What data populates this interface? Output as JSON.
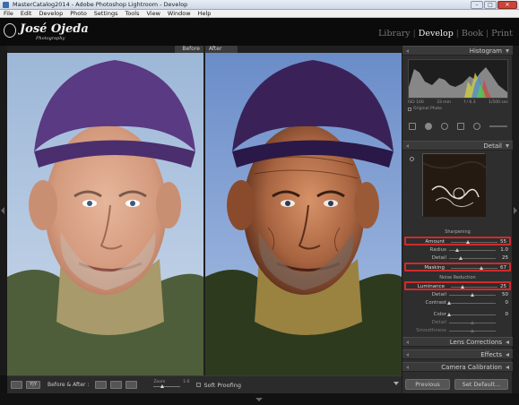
{
  "window": {
    "title": "MasterCatalog2014 - Adobe Photoshop Lightroom - Develop",
    "controls": {
      "minimize": "–",
      "maximize": "□",
      "close": "✕"
    }
  },
  "menu": [
    "File",
    "Edit",
    "Develop",
    "Photo",
    "Settings",
    "Tools",
    "View",
    "Window",
    "Help"
  ],
  "identity": {
    "name": "José Ojeda",
    "tagline": "Photography"
  },
  "modules": [
    {
      "label": "Library",
      "active": false
    },
    {
      "label": "Develop",
      "active": true
    },
    {
      "label": "Book",
      "active": false
    },
    {
      "label": "Print",
      "active": false
    }
  ],
  "preview": {
    "before_label": "Before",
    "after_label": "After"
  },
  "toolbar": {
    "before_after_label": "Before & After :",
    "zoom_label": "Zoom",
    "zoom_value": "1:6",
    "soft_proofing_label": "Soft Proofing"
  },
  "histogram": {
    "title": "Histogram",
    "info": [
      "ISO 100",
      "33 mm",
      "f / 6.3",
      "1/500 sec"
    ],
    "original_photo_label": "Original Photo"
  },
  "detail": {
    "title": "Detail",
    "sharpening_header": "Sharpening",
    "sharpening": [
      {
        "label": "Amount",
        "value": "55",
        "pct": 0.37,
        "highlight": true
      },
      {
        "label": "Radius",
        "value": "1.0",
        "pct": 0.18,
        "highlight": false
      },
      {
        "label": "Detail",
        "value": "25",
        "pct": 0.25,
        "highlight": false
      },
      {
        "label": "Masking",
        "value": "67",
        "pct": 0.67,
        "highlight": true
      }
    ],
    "noise_header": "Noise Reduction",
    "noise": [
      {
        "label": "Luminance",
        "value": "25",
        "pct": 0.25,
        "highlight": true
      },
      {
        "label": "Detail",
        "value": "50",
        "pct": 0.5,
        "highlight": false
      },
      {
        "label": "Contrast",
        "value": "0",
        "pct": 0.0,
        "highlight": false
      },
      {
        "label": "Color",
        "value": "0",
        "pct": 0.0,
        "highlight": false
      },
      {
        "label": "Detail",
        "value": "",
        "pct": 0.5,
        "highlight": false,
        "dim": true
      },
      {
        "label": "Smoothness",
        "value": "",
        "pct": 0.5,
        "highlight": false,
        "dim": true
      }
    ]
  },
  "panels_collapsed": [
    "Lens Corrections",
    "Effects",
    "Camera Calibration"
  ],
  "buttons": {
    "previous": "Previous",
    "set_default": "Set Default..."
  },
  "colors": {
    "highlight_box": "#d12a2a",
    "panel_bg": "#2e2e2e",
    "header_bg": "#3a3a3a"
  }
}
